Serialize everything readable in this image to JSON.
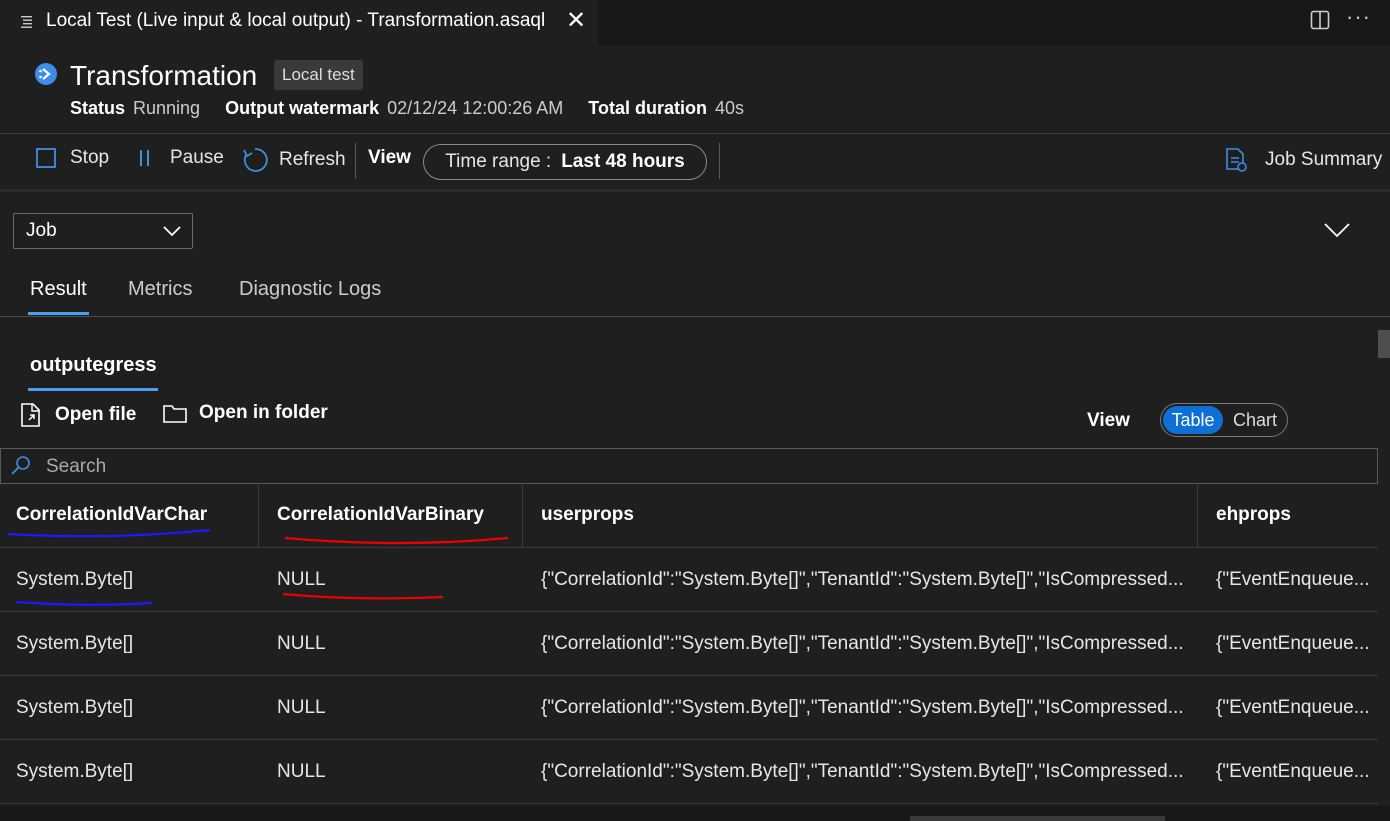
{
  "editor_tab": {
    "title": "Local Test (Live input & local output) - Transformation.asaql"
  },
  "header": {
    "title": "Transformation",
    "badge": "Local test",
    "status_label": "Status",
    "status_value": "Running",
    "watermark_label": "Output watermark",
    "watermark_value": "02/12/24 12:00:26 AM",
    "duration_label": "Total duration",
    "duration_value": "40s"
  },
  "toolbar": {
    "stop": "Stop",
    "pause": "Pause",
    "refresh": "Refresh",
    "view": "View",
    "time_range_label": "Time range :",
    "time_range_value": "Last 48 hours",
    "job_summary": "Job Summary"
  },
  "scope_dropdown": {
    "selected": "Job"
  },
  "panel_tabs": [
    "Result",
    "Metrics",
    "Diagnostic Logs"
  ],
  "output_tab": "outputegress",
  "actions": {
    "open_file": "Open file",
    "open_folder": "Open in folder"
  },
  "view_toggle": {
    "label": "View",
    "table": "Table",
    "chart": "Chart",
    "selected": "Table"
  },
  "search": {
    "placeholder": "Search"
  },
  "table": {
    "columns": [
      "CorrelationIdVarChar",
      "CorrelationIdVarBinary",
      "userprops",
      "ehprops"
    ],
    "rows": [
      [
        "System.Byte[]",
        "NULL",
        "{\"CorrelationId\":\"System.Byte[]\",\"TenantId\":\"System.Byte[]\",\"IsCompressed...",
        "{\"EventEnqueue..."
      ],
      [
        "System.Byte[]",
        "NULL",
        "{\"CorrelationId\":\"System.Byte[]\",\"TenantId\":\"System.Byte[]\",\"IsCompressed...",
        "{\"EventEnqueue..."
      ],
      [
        "System.Byte[]",
        "NULL",
        "{\"CorrelationId\":\"System.Byte[]\",\"TenantId\":\"System.Byte[]\",\"IsCompressed...",
        "{\"EventEnqueue..."
      ],
      [
        "System.Byte[]",
        "NULL",
        "{\"CorrelationId\":\"System.Byte[]\",\"TenantId\":\"System.Byte[]\",\"IsCompressed...",
        "{\"EventEnqueue..."
      ]
    ]
  },
  "colors": {
    "accent": "#4aa0f0",
    "toggle_active": "#0e70d4",
    "annotation_blue": "#1a1aff",
    "annotation_red": "#ee0000"
  }
}
